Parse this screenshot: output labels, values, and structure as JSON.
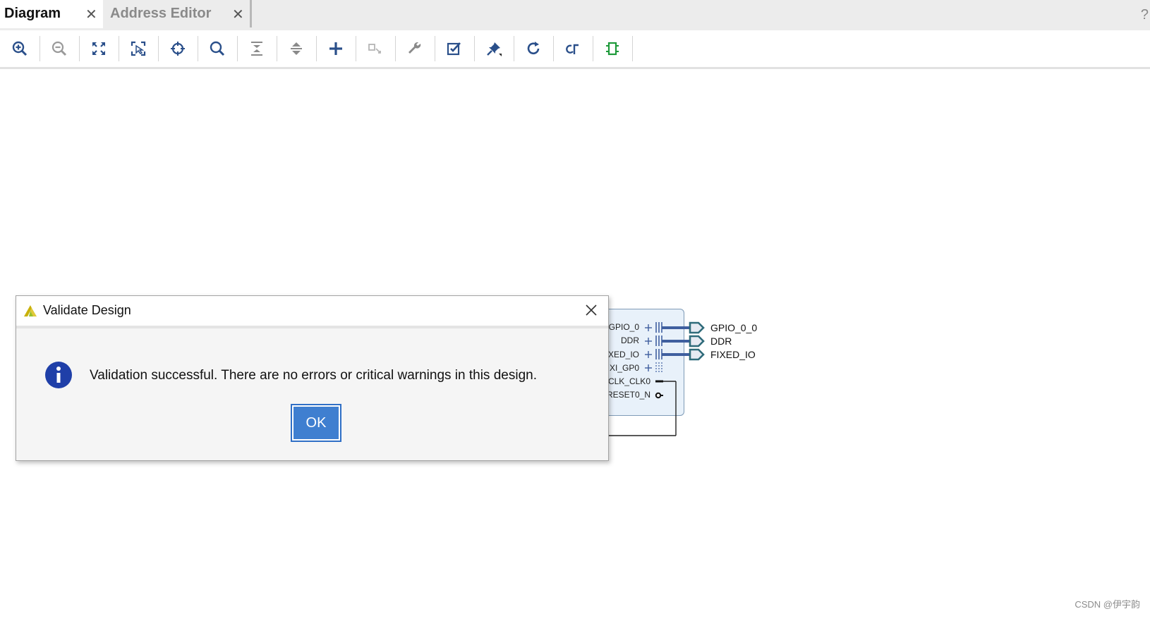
{
  "tabs": [
    {
      "label": "Diagram",
      "close": "✕",
      "active": true
    },
    {
      "label": "Address Editor",
      "close": "✕",
      "active": false
    }
  ],
  "help_glyph": "?",
  "toolbar": {
    "buttons": [
      {
        "icon": "zoom-in-icon",
        "enabled": true
      },
      {
        "icon": "zoom-out-icon",
        "enabled": false
      },
      {
        "icon": "zoom-fit-icon",
        "enabled": true
      },
      {
        "icon": "zoom-area-icon",
        "enabled": true
      },
      {
        "icon": "auto-fit-selection-icon",
        "enabled": true
      },
      {
        "icon": "search-icon",
        "enabled": true
      },
      {
        "icon": "collapse-all-icon",
        "enabled": true
      },
      {
        "icon": "expand-all-icon",
        "enabled": true
      },
      {
        "icon": "add-ip-icon",
        "enabled": true
      },
      {
        "icon": "make-connection-icon",
        "enabled": false
      },
      {
        "icon": "wrench-icon",
        "enabled": true
      },
      {
        "icon": "validate-design-icon",
        "enabled": true
      },
      {
        "icon": "pin-icon",
        "enabled": true
      },
      {
        "icon": "regenerate-layout-icon",
        "enabled": true
      },
      {
        "icon": "optimize-routing-icon",
        "enabled": true
      },
      {
        "icon": "board-icon",
        "enabled": true
      }
    ]
  },
  "diagram": {
    "block_ports": [
      "GPIO_0",
      "DDR",
      "XED_IO",
      "XI_GP0",
      "CLK_CLK0",
      "RESET0_N"
    ],
    "external_ports": [
      "GPIO_0_0",
      "DDR",
      "FIXED_IO"
    ],
    "colors": {
      "block_fill": "#e8f1fa",
      "wire": "#3f5f9f",
      "port_arrow": "#2f6b7a"
    }
  },
  "dialog": {
    "title": "Validate Design",
    "message": "Validation successful. There are no errors or critical warnings in this design.",
    "ok_label": "OK",
    "icons": {
      "logo": "vivado-logo-icon",
      "info": "info-icon",
      "close": "close-icon"
    },
    "colors": {
      "info": "#1f3fa8",
      "ok_button": "#3f7fd0"
    }
  },
  "watermark": "CSDN @伊宇韵"
}
